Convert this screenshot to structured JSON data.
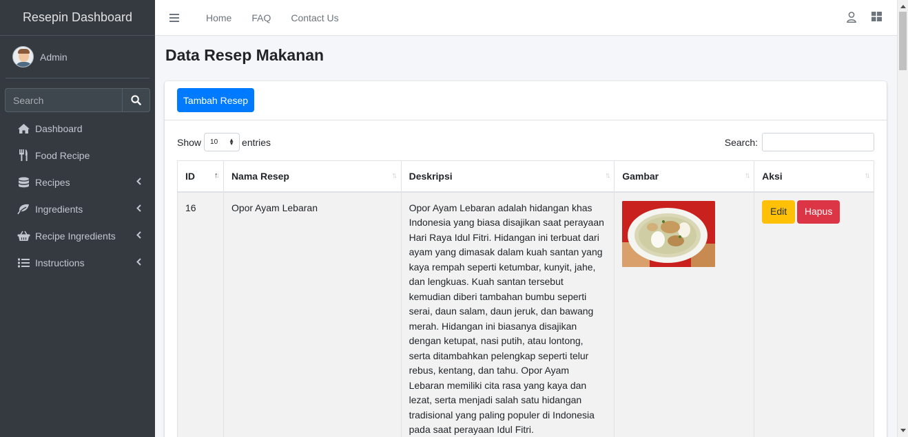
{
  "sidebar": {
    "brand": "Resepin Dashboard",
    "user_name": "Admin",
    "search_placeholder": "Search",
    "items": [
      {
        "label": "Dashboard",
        "icon": "home-icon"
      },
      {
        "label": "Food Recipe",
        "icon": "utensils-icon"
      },
      {
        "label": "Recipes",
        "icon": "database-icon",
        "has_children": true
      },
      {
        "label": "Ingredients",
        "icon": "leaf-icon",
        "has_children": true
      },
      {
        "label": "Recipe Ingredients",
        "icon": "basket-icon",
        "has_children": true
      },
      {
        "label": "Instructions",
        "icon": "list-icon",
        "has_children": true
      }
    ]
  },
  "topbar": {
    "links": [
      "Home",
      "FAQ",
      "Contact Us"
    ],
    "right_icons": [
      "user-icon",
      "grid-icon"
    ]
  },
  "page": {
    "title": "Data Resep Makanan",
    "add_button": "Tambah Resep"
  },
  "table_controls": {
    "show_label": "Show",
    "entries_value": "10",
    "entries_label": "entries",
    "search_label": "Search:"
  },
  "table": {
    "columns": [
      "ID",
      "Nama Resep",
      "Deskripsi",
      "Gambar",
      "Aksi"
    ],
    "rows": [
      {
        "id": "16",
        "name": "Opor Ayam Lebaran",
        "description": "Opor Ayam Lebaran adalah hidangan khas Indonesia yang biasa disajikan saat perayaan Hari Raya Idul Fitri. Hidangan ini terbuat dari ayam yang dimasak dalam kuah santan yang kaya rempah seperti ketumbar, kunyit, jahe, dan lengkuas. Kuah santan tersebut kemudian diberi tambahan bumbu seperti serai, daun salam, daun jeruk, dan bawang merah. Hidangan ini biasanya disajikan dengan ketupat, nasi putih, atau lontong, serta ditambahkan pelengkap seperti telur rebus, kentang, dan tahu. Opor Ayam Lebaran memiliki cita rasa yang kaya dan lezat, serta menjadi salah satu hidangan tradisional yang paling populer di Indonesia pada saat perayaan Idul Fitri.",
        "edit_label": "Edit",
        "delete_label": "Hapus"
      }
    ]
  },
  "colors": {
    "sidebar_bg": "#343a40",
    "primary": "#007bff",
    "warning": "#ffc107",
    "danger": "#dc3545"
  }
}
